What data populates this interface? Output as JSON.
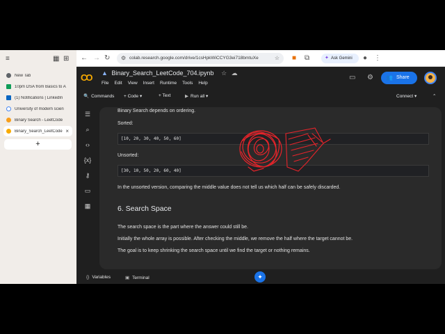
{
  "browser": {
    "tabs": [
      {
        "title": "New Tab",
        "favicon_color": "#5f6368",
        "active": false
      },
      {
        "title": "10pm DSA from Basics to A",
        "favicon_color": "#0f9d58",
        "active": false
      },
      {
        "title": "(1) Notifications | LinkedIn",
        "favicon_color": "#0a66c2",
        "active": false
      },
      {
        "title": "University of modern scien",
        "favicon_color": "#4285f4",
        "active": false
      },
      {
        "title": "Binary Search - LeetCode",
        "favicon_color": "#f89f1b",
        "active": false
      },
      {
        "title": "Binary_Search_LeetCode",
        "favicon_color": "#f9ab00",
        "active": true
      }
    ],
    "newtab_label": "+",
    "url": "colab.research.google.com/drive/1csHpkWiCCYG3ei718bmtuXe",
    "ask_gemini_label": "Ask Gemini"
  },
  "colab": {
    "logo_text": "CO",
    "notebook_title": "Binary_Search_LeetCode_704.ipynb",
    "menu": [
      "File",
      "Edit",
      "View",
      "Insert",
      "Runtime",
      "Tools",
      "Help"
    ],
    "share_label": "Share",
    "toolbar": {
      "commands": "Commands",
      "add_code": "+ Code",
      "add_text": "+ Text",
      "run_all": "Run all",
      "connect": "Connect"
    }
  },
  "cell": {
    "line1": "Binary Search depends on ordering.",
    "sorted_label": "Sorted:",
    "sorted_code": "[10, 20, 30, 40, 50, 60]",
    "unsorted_label": "Unsorted:",
    "unsorted_code": "[30, 10, 50, 20, 60, 40]",
    "unsorted_note": "In the unsorted version, comparing the middle value does not tell us which half can be safely discarded.",
    "heading": "6. Search Space",
    "para1": "The search space is the part where the answer could still be.",
    "para2": "Initially the whole array is possible. After checking the middle, we remove the half where the target cannot be.",
    "para3": "The goal is to keep shrinking the search space until we find the target or nothing remains."
  },
  "statusbar": {
    "variables": "Variables",
    "terminal": "Terminal"
  },
  "colors": {
    "accent": "#1a73e8",
    "annotation": "#e8242a"
  }
}
